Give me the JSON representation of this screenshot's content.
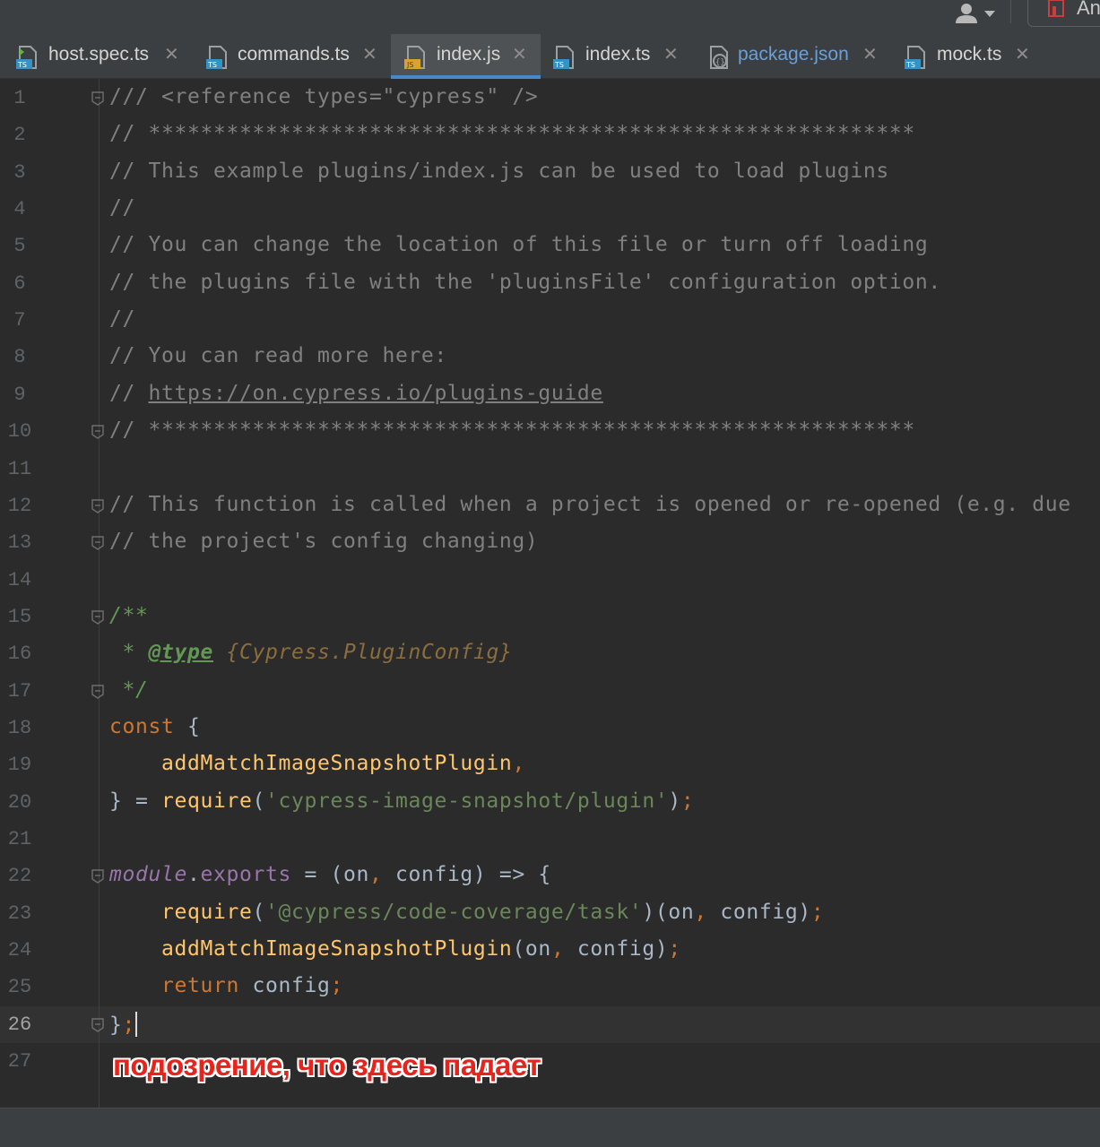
{
  "toolbar": {
    "user_icon": "user-icon",
    "run_label": "An"
  },
  "tabs": [
    {
      "name": "host.spec.ts",
      "icon": "typescript-test-file-icon",
      "active": false
    },
    {
      "name": "commands.ts",
      "icon": "typescript-file-icon",
      "active": false
    },
    {
      "name": "index.js",
      "icon": "javascript-file-icon",
      "active": true
    },
    {
      "name": "index.ts",
      "icon": "typescript-file-icon",
      "active": false
    },
    {
      "name": "package.json",
      "icon": "json-file-icon",
      "active": false
    },
    {
      "name": "mock.ts",
      "icon": "typescript-file-icon",
      "active": false
    }
  ],
  "editor": {
    "current_line": 26,
    "lines": [
      {
        "n": "1",
        "text": "/// <reference types=\"cypress\" />"
      },
      {
        "n": "2",
        "text": "// ***********************************************************"
      },
      {
        "n": "3",
        "text": "// This example plugins/index.js can be used to load plugins"
      },
      {
        "n": "4",
        "text": "//"
      },
      {
        "n": "5",
        "text": "// You can change the location of this file or turn off loading"
      },
      {
        "n": "6",
        "text": "// the plugins file with the 'pluginsFile' configuration option."
      },
      {
        "n": "7",
        "text": "//"
      },
      {
        "n": "8",
        "text": "// You can read more here:"
      },
      {
        "n": "9",
        "prefix": "// ",
        "url": "https://on.cypress.io/plugins-guide"
      },
      {
        "n": "10",
        "text": "// ***********************************************************"
      },
      {
        "n": "11",
        "text": ""
      },
      {
        "n": "12",
        "text": "// This function is called when a project is opened or re-opened (e.g. due"
      },
      {
        "n": "13",
        "text": "// the project's config changing)"
      },
      {
        "n": "14",
        "text": ""
      },
      {
        "n": "15",
        "text": "/**"
      },
      {
        "n": "16",
        "star": " * ",
        "tag": "@type",
        "type": "{Cypress.PluginConfig}"
      },
      {
        "n": "17",
        "text": " */"
      },
      {
        "n": "18",
        "kw": "const",
        "rest": " {"
      },
      {
        "n": "19",
        "fn": "addMatchImageSnapshotPlugin",
        "punct": ","
      },
      {
        "n": "20",
        "pre": "} = ",
        "fn": "require",
        "open": "(",
        "str": "'cypress-image-snapshot/plugin'",
        "close": ")",
        "semi": ";"
      },
      {
        "n": "21",
        "text": ""
      },
      {
        "n": "22",
        "mod": "module",
        "dot": ".",
        "prop": "exports",
        "rest": " = (on",
        "comma": ",",
        "rest2": " config) => {"
      },
      {
        "n": "23",
        "fn": "require",
        "open": "(",
        "str": "'@cypress/code-coverage/task'",
        "close": ")(on",
        "comma": ",",
        "rest": " config)",
        "semi": ";"
      },
      {
        "n": "24",
        "fn": "addMatchImageSnapshotPlugin",
        "open": "(on",
        "comma": ",",
        "rest": " config)",
        "semi": ";"
      },
      {
        "n": "25",
        "kw": "return",
        "rest": " config",
        "semi": ";"
      },
      {
        "n": "26",
        "rest": "}",
        "semi": ";"
      },
      {
        "n": "27",
        "text": ""
      }
    ]
  },
  "annotation": "подозрение, что здесь падает",
  "colors": {
    "background": "#2b2b2b",
    "keyword": "#cc7832",
    "function": "#ffc66d",
    "string": "#6a8759",
    "comment": "#808080",
    "doc_comment": "#629755",
    "annotation": "#e8231c"
  }
}
